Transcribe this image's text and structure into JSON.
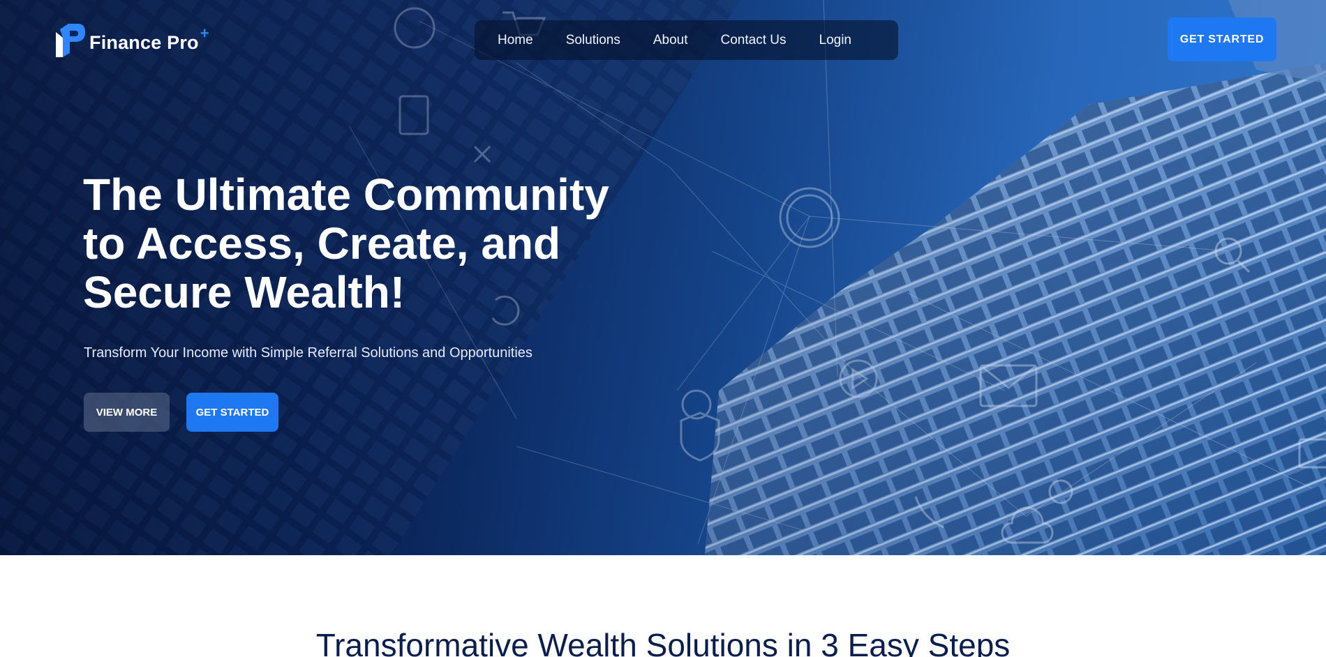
{
  "brand": {
    "name": "Finance Pro",
    "mark": "+",
    "accent_color": "#1d78f2"
  },
  "nav": {
    "items": [
      {
        "label": "Home"
      },
      {
        "label": "Solutions"
      },
      {
        "label": "About"
      },
      {
        "label": "Contact Us"
      },
      {
        "label": "Login"
      }
    ],
    "cta_label": "GET STARTED"
  },
  "hero": {
    "title_lines": [
      "The Ultimate Community",
      "to Access, Create, and",
      "Secure Wealth!"
    ],
    "subtitle": "Transform Your Income with Simple Referral Solutions and Opportunities",
    "view_more_label": "VIEW MORE",
    "get_started_label": "GET STARTED",
    "background_colors": [
      "#03123a",
      "#184b93",
      "#2f78cf"
    ]
  },
  "section": {
    "title": "Transformative Wealth Solutions in 3 Easy Steps"
  }
}
